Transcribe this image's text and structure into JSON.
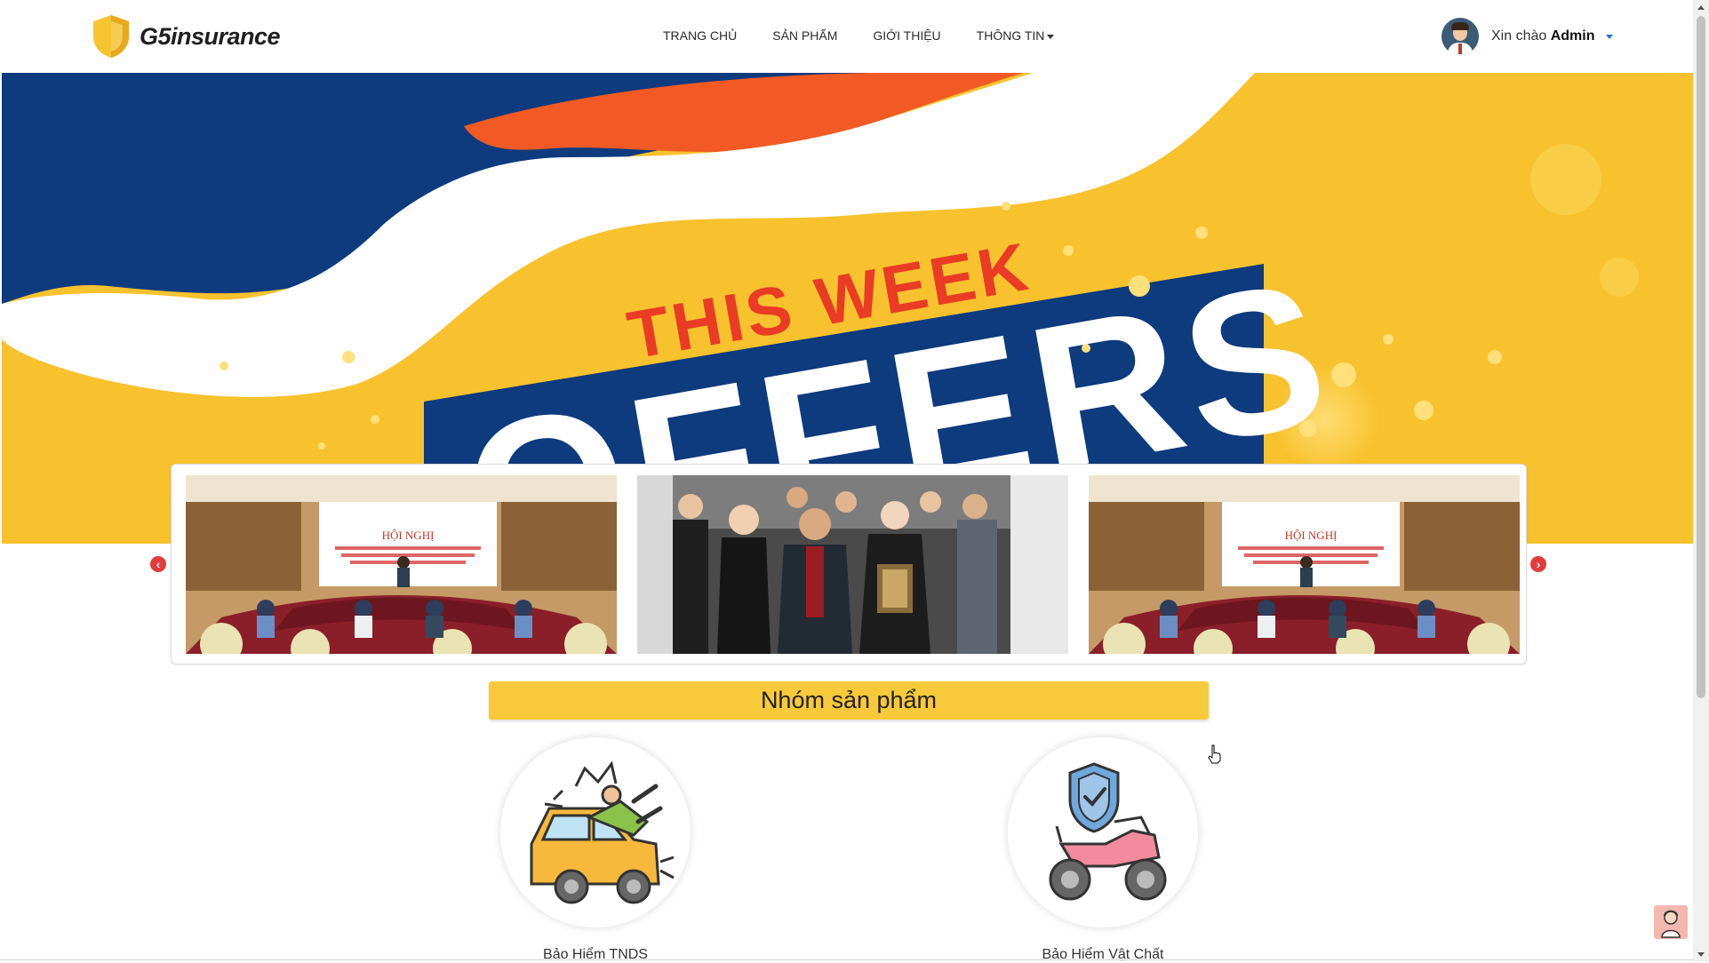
{
  "brand": {
    "name": "G5insurance"
  },
  "nav": {
    "items": [
      {
        "label": "TRANG CHỦ"
      },
      {
        "label": "SẢN PHẨM"
      },
      {
        "label": "GIỚI THIỆU"
      },
      {
        "label": "THÔNG TIN"
      }
    ]
  },
  "user": {
    "greeting": "Xin chào",
    "name": "Admin"
  },
  "banner": {
    "headline": "THIS WEEK",
    "subline": "OFFERS"
  },
  "carousel": {
    "slides": [
      {
        "type": "conference-photo"
      },
      {
        "type": "group-photo"
      },
      {
        "type": "conference-photo"
      }
    ],
    "slide_caption": "HỘI NGHỊ"
  },
  "section": {
    "title": "Nhóm sản phẩm"
  },
  "products": [
    {
      "label": "Bảo Hiểm TNDS",
      "icon": "car-accident-icon"
    },
    {
      "label": "Bảo Hiểm Vật Chất",
      "icon": "motorbike-shield-icon"
    }
  ],
  "colors": {
    "accent": "#f8c93a",
    "navy": "#0e3a7e",
    "orange": "#f15a24",
    "arrow": "#e23c3c"
  }
}
